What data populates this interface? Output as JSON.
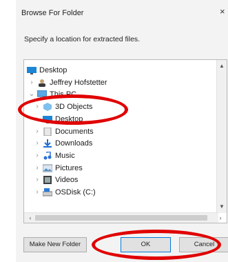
{
  "window": {
    "title": "Browse For Folder",
    "close_glyph": "×"
  },
  "instruction": "Specify a location for extracted files.",
  "tree": {
    "items": [
      {
        "label": "Desktop",
        "icon": "desktop-icon",
        "chevron": "",
        "indent": 0
      },
      {
        "label": "Jeffrey Hofstetter",
        "icon": "user-icon",
        "chevron": "›",
        "indent": 1
      },
      {
        "label": "This PC",
        "icon": "computer-icon",
        "chevron": "⌄",
        "indent": 1
      },
      {
        "label": "3D Objects",
        "icon": "cube-icon",
        "chevron": "›",
        "indent": 2
      },
      {
        "label": "Desktop",
        "icon": "desktop-icon",
        "chevron": "›",
        "indent": 2
      },
      {
        "label": "Documents",
        "icon": "documents-icon",
        "chevron": "›",
        "indent": 2
      },
      {
        "label": "Downloads",
        "icon": "download-icon",
        "chevron": "›",
        "indent": 2
      },
      {
        "label": "Music",
        "icon": "music-icon",
        "chevron": "›",
        "indent": 2
      },
      {
        "label": "Pictures",
        "icon": "pictures-icon",
        "chevron": "›",
        "indent": 2
      },
      {
        "label": "Videos",
        "icon": "videos-icon",
        "chevron": "›",
        "indent": 2
      },
      {
        "label": "OSDisk (C:)",
        "icon": "drive-icon",
        "chevron": "›",
        "indent": 2
      }
    ],
    "scroll_up": "▲",
    "scroll_down": "▼",
    "scroll_left": "‹",
    "scroll_right": "›"
  },
  "buttons": {
    "make_new_folder": "Make New Folder",
    "ok": "OK",
    "cancel": "Cancel"
  },
  "annotation_color": "#e00000"
}
